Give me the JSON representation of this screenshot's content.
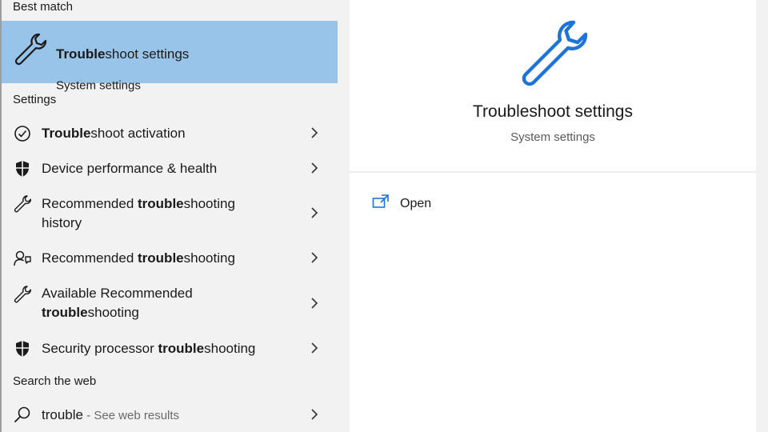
{
  "best_match": {
    "header": "Best match",
    "title_bold": "Trouble",
    "title_rest": "shoot settings",
    "subtitle": "System settings",
    "icon": "wrench-icon"
  },
  "settings": {
    "header": "Settings",
    "items": [
      {
        "pre": "",
        "bold": "Trouble",
        "post": "shoot activation",
        "line2": "",
        "icon": "check-circle-icon"
      },
      {
        "pre": "Device performance & health",
        "bold": "",
        "post": "",
        "line2": "",
        "icon": "shield-icon"
      },
      {
        "pre": "Recommended ",
        "bold": "trouble",
        "post": "shooting",
        "line2": "history",
        "icon": "wrench-icon"
      },
      {
        "pre": "Recommended ",
        "bold": "trouble",
        "post": "shooting",
        "line2": "",
        "icon": "person-help-icon"
      },
      {
        "pre": "Available Recommended",
        "bold": "",
        "post": "",
        "line2_bold": "trouble",
        "line2": "shooting",
        "icon": "wrench-icon"
      },
      {
        "pre": "Security processor ",
        "bold": "trouble",
        "post": "shooting",
        "line2": "",
        "icon": "shield-icon"
      }
    ]
  },
  "web": {
    "header": "Search the web",
    "query": "trouble",
    "suffix": " - See web results",
    "icon": "search-icon"
  },
  "preview": {
    "title": "Troubleshoot settings",
    "subtitle": "System settings",
    "open_label": "Open",
    "accent": "#1e73d8"
  }
}
